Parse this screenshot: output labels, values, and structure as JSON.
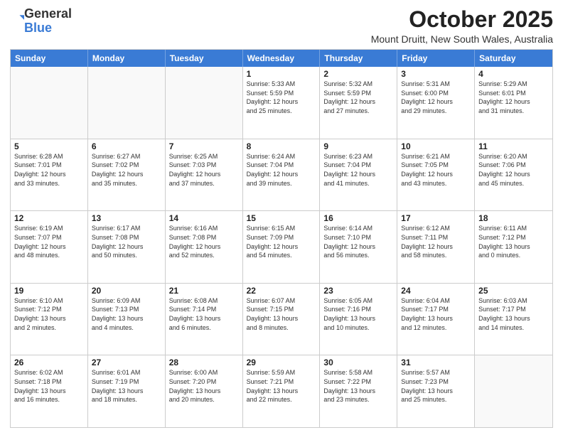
{
  "header": {
    "logo_general": "General",
    "logo_blue": "Blue",
    "month_title": "October 2025",
    "location": "Mount Druitt, New South Wales, Australia"
  },
  "day_headers": [
    "Sunday",
    "Monday",
    "Tuesday",
    "Wednesday",
    "Thursday",
    "Friday",
    "Saturday"
  ],
  "weeks": [
    [
      {
        "num": "",
        "info": ""
      },
      {
        "num": "",
        "info": ""
      },
      {
        "num": "",
        "info": ""
      },
      {
        "num": "1",
        "info": "Sunrise: 5:33 AM\nSunset: 5:59 PM\nDaylight: 12 hours\nand 25 minutes."
      },
      {
        "num": "2",
        "info": "Sunrise: 5:32 AM\nSunset: 5:59 PM\nDaylight: 12 hours\nand 27 minutes."
      },
      {
        "num": "3",
        "info": "Sunrise: 5:31 AM\nSunset: 6:00 PM\nDaylight: 12 hours\nand 29 minutes."
      },
      {
        "num": "4",
        "info": "Sunrise: 5:29 AM\nSunset: 6:01 PM\nDaylight: 12 hours\nand 31 minutes."
      }
    ],
    [
      {
        "num": "5",
        "info": "Sunrise: 6:28 AM\nSunset: 7:01 PM\nDaylight: 12 hours\nand 33 minutes."
      },
      {
        "num": "6",
        "info": "Sunrise: 6:27 AM\nSunset: 7:02 PM\nDaylight: 12 hours\nand 35 minutes."
      },
      {
        "num": "7",
        "info": "Sunrise: 6:25 AM\nSunset: 7:03 PM\nDaylight: 12 hours\nand 37 minutes."
      },
      {
        "num": "8",
        "info": "Sunrise: 6:24 AM\nSunset: 7:04 PM\nDaylight: 12 hours\nand 39 minutes."
      },
      {
        "num": "9",
        "info": "Sunrise: 6:23 AM\nSunset: 7:04 PM\nDaylight: 12 hours\nand 41 minutes."
      },
      {
        "num": "10",
        "info": "Sunrise: 6:21 AM\nSunset: 7:05 PM\nDaylight: 12 hours\nand 43 minutes."
      },
      {
        "num": "11",
        "info": "Sunrise: 6:20 AM\nSunset: 7:06 PM\nDaylight: 12 hours\nand 45 minutes."
      }
    ],
    [
      {
        "num": "12",
        "info": "Sunrise: 6:19 AM\nSunset: 7:07 PM\nDaylight: 12 hours\nand 48 minutes."
      },
      {
        "num": "13",
        "info": "Sunrise: 6:17 AM\nSunset: 7:08 PM\nDaylight: 12 hours\nand 50 minutes."
      },
      {
        "num": "14",
        "info": "Sunrise: 6:16 AM\nSunset: 7:08 PM\nDaylight: 12 hours\nand 52 minutes."
      },
      {
        "num": "15",
        "info": "Sunrise: 6:15 AM\nSunset: 7:09 PM\nDaylight: 12 hours\nand 54 minutes."
      },
      {
        "num": "16",
        "info": "Sunrise: 6:14 AM\nSunset: 7:10 PM\nDaylight: 12 hours\nand 56 minutes."
      },
      {
        "num": "17",
        "info": "Sunrise: 6:12 AM\nSunset: 7:11 PM\nDaylight: 12 hours\nand 58 minutes."
      },
      {
        "num": "18",
        "info": "Sunrise: 6:11 AM\nSunset: 7:12 PM\nDaylight: 13 hours\nand 0 minutes."
      }
    ],
    [
      {
        "num": "19",
        "info": "Sunrise: 6:10 AM\nSunset: 7:12 PM\nDaylight: 13 hours\nand 2 minutes."
      },
      {
        "num": "20",
        "info": "Sunrise: 6:09 AM\nSunset: 7:13 PM\nDaylight: 13 hours\nand 4 minutes."
      },
      {
        "num": "21",
        "info": "Sunrise: 6:08 AM\nSunset: 7:14 PM\nDaylight: 13 hours\nand 6 minutes."
      },
      {
        "num": "22",
        "info": "Sunrise: 6:07 AM\nSunset: 7:15 PM\nDaylight: 13 hours\nand 8 minutes."
      },
      {
        "num": "23",
        "info": "Sunrise: 6:05 AM\nSunset: 7:16 PM\nDaylight: 13 hours\nand 10 minutes."
      },
      {
        "num": "24",
        "info": "Sunrise: 6:04 AM\nSunset: 7:17 PM\nDaylight: 13 hours\nand 12 minutes."
      },
      {
        "num": "25",
        "info": "Sunrise: 6:03 AM\nSunset: 7:17 PM\nDaylight: 13 hours\nand 14 minutes."
      }
    ],
    [
      {
        "num": "26",
        "info": "Sunrise: 6:02 AM\nSunset: 7:18 PM\nDaylight: 13 hours\nand 16 minutes."
      },
      {
        "num": "27",
        "info": "Sunrise: 6:01 AM\nSunset: 7:19 PM\nDaylight: 13 hours\nand 18 minutes."
      },
      {
        "num": "28",
        "info": "Sunrise: 6:00 AM\nSunset: 7:20 PM\nDaylight: 13 hours\nand 20 minutes."
      },
      {
        "num": "29",
        "info": "Sunrise: 5:59 AM\nSunset: 7:21 PM\nDaylight: 13 hours\nand 22 minutes."
      },
      {
        "num": "30",
        "info": "Sunrise: 5:58 AM\nSunset: 7:22 PM\nDaylight: 13 hours\nand 23 minutes."
      },
      {
        "num": "31",
        "info": "Sunrise: 5:57 AM\nSunset: 7:23 PM\nDaylight: 13 hours\nand 25 minutes."
      },
      {
        "num": "",
        "info": ""
      }
    ]
  ]
}
